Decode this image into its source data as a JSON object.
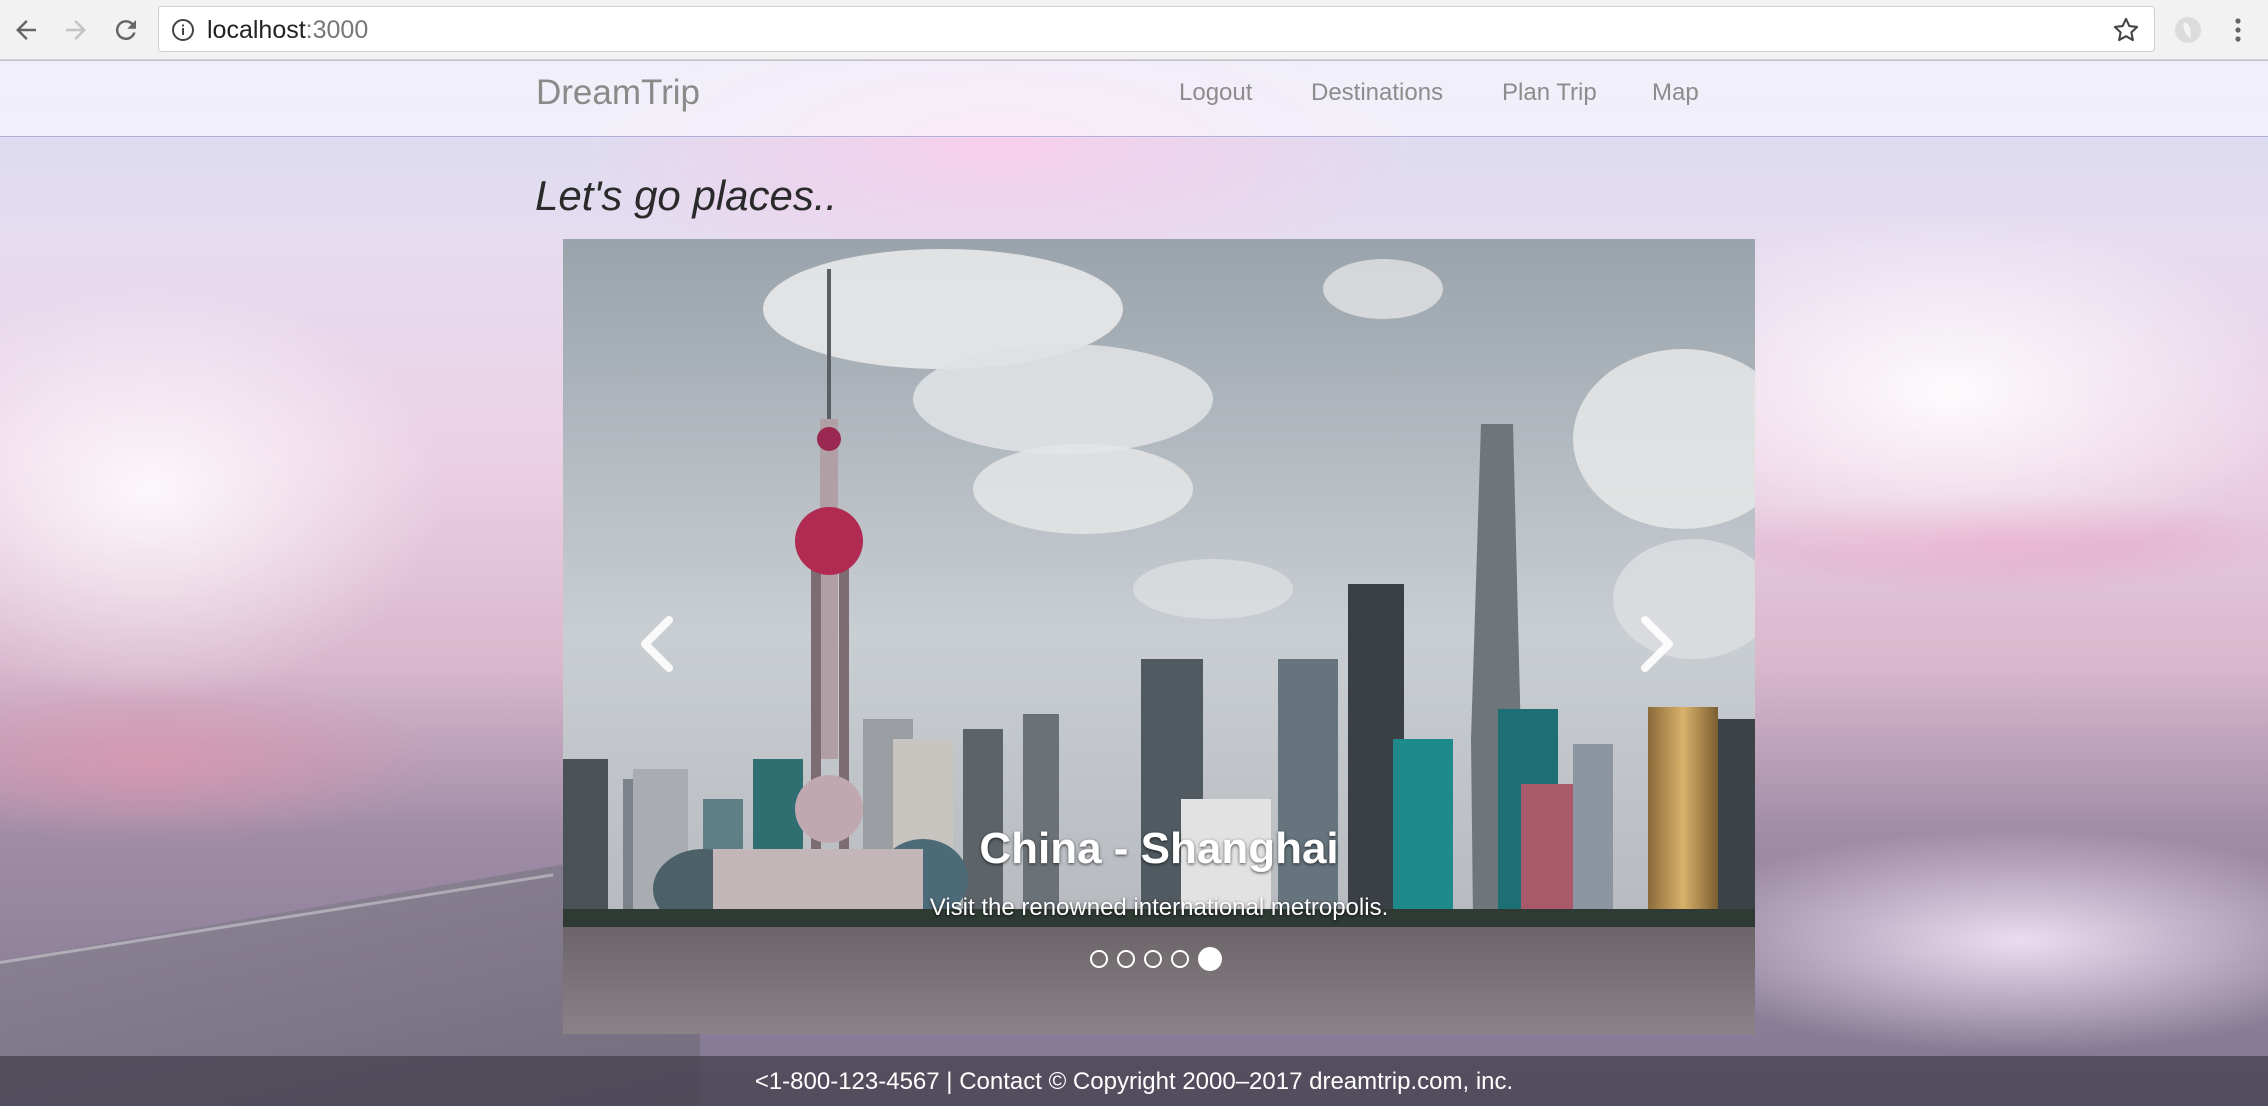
{
  "browser": {
    "url_host": "localhost",
    "url_port": ":3000",
    "icons": {
      "back": "arrow-left-icon",
      "forward": "arrow-right-icon",
      "reload": "reload-icon",
      "info": "info-icon",
      "bookmark": "star-icon",
      "extension": "extension-icon",
      "menu": "kebab-menu-icon"
    }
  },
  "navbar": {
    "brand": "DreamTrip",
    "links": [
      "Logout",
      "Destinations",
      "Plan Trip",
      "Map"
    ]
  },
  "hero": {
    "tagline": "Let's go places.."
  },
  "carousel": {
    "slide_title": "China - Shanghai",
    "slide_text": "Visit the renowned international metropolis.",
    "slide_count": 5,
    "active_slide": 5,
    "prev_icon": "chevron-left-icon",
    "next_icon": "chevron-right-icon"
  },
  "footer": {
    "text": "<1-800-123-4567 | Contact © Copyright 2000–2017 dreamtrip.com, inc."
  },
  "colors": {
    "navbar_border": "#b3b0d6",
    "footer_bg": "#464150",
    "nav_text": "#8c8c8c"
  }
}
